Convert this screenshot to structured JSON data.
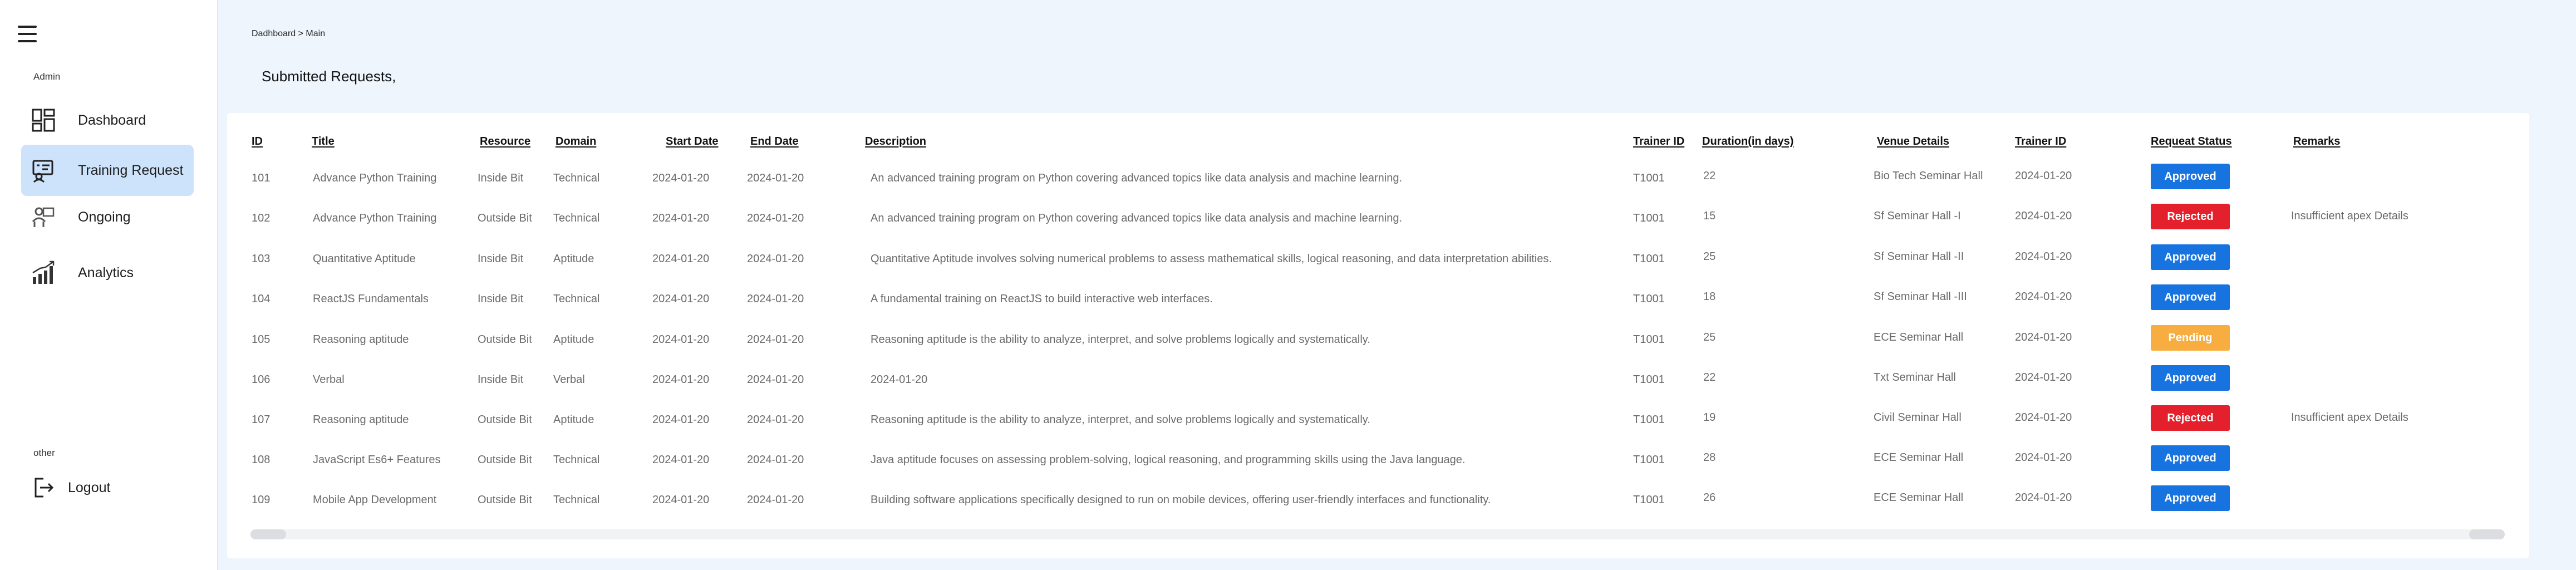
{
  "sidebar": {
    "sections": {
      "admin": "Admin",
      "other": "other"
    },
    "items": [
      {
        "label": "Dashboard",
        "icon": "dashboard-icon",
        "active": false
      },
      {
        "label": "Training Request",
        "icon": "training-request-icon",
        "active": true
      },
      {
        "label": "Ongoing",
        "icon": "ongoing-icon",
        "active": false
      },
      {
        "label": "Analytics",
        "icon": "analytics-icon",
        "active": false
      }
    ],
    "logout": {
      "label": "Logout",
      "icon": "logout-icon"
    }
  },
  "breadcrumb": {
    "root": "Dadhboard",
    "separator": ">",
    "current": "Main"
  },
  "page": {
    "heading": "Submitted Requests,"
  },
  "table": {
    "headers": {
      "id": "ID",
      "title": "Title",
      "resource": "Resource",
      "domain": "Domain",
      "start": "Start Date",
      "end": "End Date",
      "description": "Description",
      "trainer_id": "Trainer ID",
      "duration": "Duration(in days)",
      "venue": "Venue Details",
      "trainer_id2": "Trainer ID",
      "status": "Requeat Status",
      "remarks": "Remarks"
    },
    "rows": [
      {
        "id": "101",
        "title": "Advance Python Training",
        "resource": "Inside Bit",
        "domain": "Technical",
        "start": "2024-01-20",
        "end": "2024-01-20",
        "description": "An advanced training program on Python covering advanced topics like data analysis and machine learning.",
        "trainer_id": "T1001",
        "duration": "22",
        "venue": "Bio Tech Seminar Hall",
        "date": "2024-01-20",
        "status": "Approved",
        "remarks": ""
      },
      {
        "id": "102",
        "title": "Advance Python Training",
        "resource": "Outside Bit",
        "domain": "Technical",
        "start": "2024-01-20",
        "end": "2024-01-20",
        "description": "An advanced training program on Python covering advanced topics like data analysis and machine learning.",
        "trainer_id": "T1001",
        "duration": "15",
        "venue": "Sf Seminar Hall -I",
        "date": "2024-01-20",
        "status": "Rejected",
        "remarks": "Insufficient apex Details"
      },
      {
        "id": "103",
        "title": "Quantitative Aptitude",
        "resource": "Inside Bit",
        "domain": "Aptitude",
        "start": "2024-01-20",
        "end": "2024-01-20",
        "description": "Quantitative Aptitude involves solving numerical problems to assess mathematical skills, logical reasoning, and data interpretation abilities.",
        "trainer_id": "T1001",
        "duration": "25",
        "venue": "Sf Seminar Hall -II",
        "date": "2024-01-20",
        "status": "Approved",
        "remarks": ""
      },
      {
        "id": "104",
        "title": "ReactJS Fundamentals",
        "resource": "Inside Bit",
        "domain": "Technical",
        "start": "2024-01-20",
        "end": "2024-01-20",
        "description": "A fundamental training on ReactJS to build interactive web interfaces.",
        "trainer_id": "T1001",
        "duration": "18",
        "venue": "Sf Seminar Hall -III",
        "date": "2024-01-20",
        "status": "Approved",
        "remarks": ""
      },
      {
        "id": "105",
        "title": "Reasoning aptitude",
        "resource": "Outside Bit",
        "domain": "Aptitude",
        "start": "2024-01-20",
        "end": "2024-01-20",
        "description": "Reasoning aptitude is the ability to analyze, interpret, and solve problems logically and systematically.",
        "trainer_id": "T1001",
        "duration": "25",
        "venue": "ECE Seminar Hall",
        "date": "2024-01-20",
        "status": "Pending",
        "remarks": ""
      },
      {
        "id": "106",
        "title": "Verbal",
        "resource": "Inside Bit",
        "domain": "Verbal",
        "start": "2024-01-20",
        "end": "2024-01-20",
        "description": "2024-01-20",
        "trainer_id": "T1001",
        "duration": "22",
        "venue": "Txt Seminar Hall",
        "date": "2024-01-20",
        "status": "Approved",
        "remarks": ""
      },
      {
        "id": "107",
        "title": "Reasoning aptitude",
        "resource": "Outside Bit",
        "domain": "Aptitude",
        "start": "2024-01-20",
        "end": "2024-01-20",
        "description": "Reasoning aptitude is the ability to analyze, interpret, and solve problems logically and systematically.",
        "trainer_id": "T1001",
        "duration": "19",
        "venue": "Civil Seminar Hall",
        "date": "2024-01-20",
        "status": "Rejected",
        "remarks": "Insufficient apex Details"
      },
      {
        "id": "108",
        "title": "JavaScript Es6+ Features",
        "resource": "Outside Bit",
        "domain": "Technical",
        "start": "2024-01-20",
        "end": "2024-01-20",
        "description": "Java aptitude focuses on assessing problem-solving, logical reasoning, and programming skills using the Java language.",
        "trainer_id": "T1001",
        "duration": "28",
        "venue": "ECE Seminar Hall",
        "date": "2024-01-20",
        "status": "Approved",
        "remarks": ""
      },
      {
        "id": "109",
        "title": "Mobile App Development",
        "resource": "Outside Bit",
        "domain": "Technical",
        "start": "2024-01-20",
        "end": "2024-01-20",
        "description": "Building software applications specifically designed to run on mobile devices, offering user-friendly interfaces and functionality.",
        "trainer_id": "T1001",
        "duration": "26",
        "venue": "ECE Seminar Hall",
        "date": "2024-01-20",
        "status": "Approved",
        "remarks": ""
      }
    ]
  },
  "colors": {
    "approved": "#1773df",
    "rejected": "#e3202b",
    "pending": "#f7ad3f",
    "active_nav": "#cde3fb",
    "background": "#eef5fd"
  }
}
